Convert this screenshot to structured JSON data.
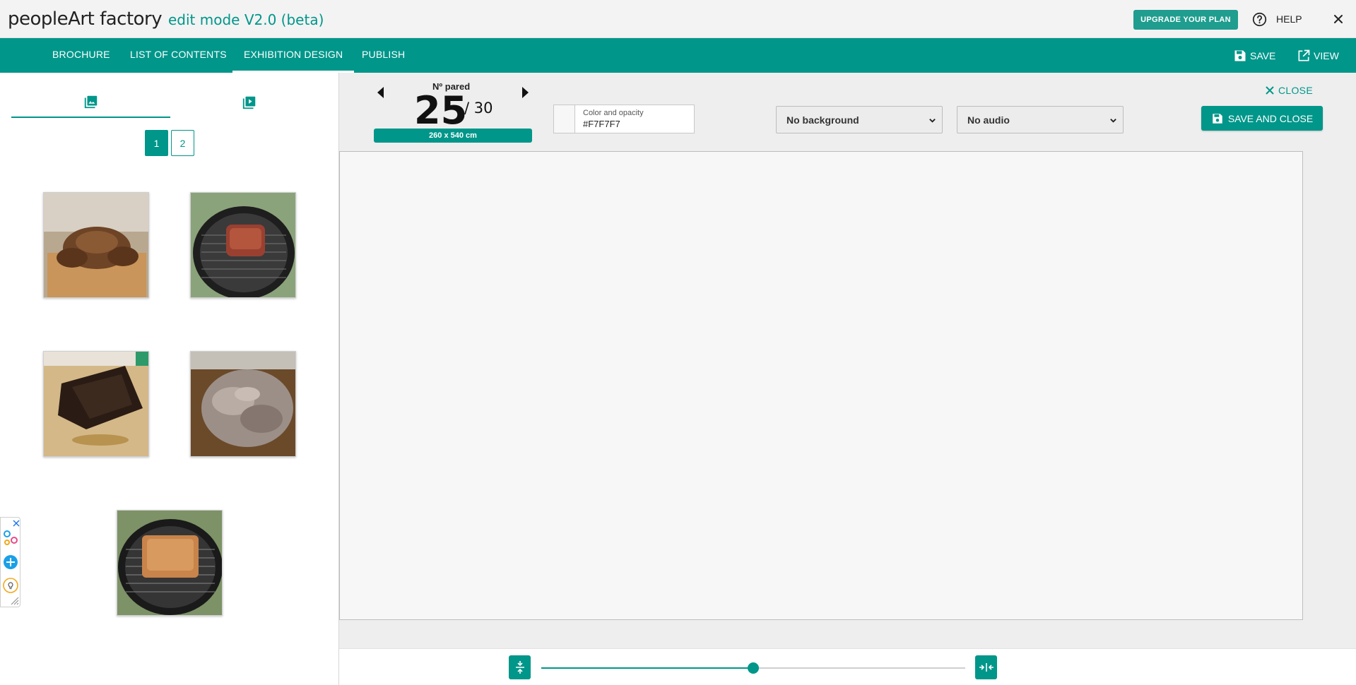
{
  "app": {
    "brand": "peopleArt factory",
    "mode": "edit mode V2.0 (beta)",
    "upgrade_label": "UPGRADE YOUR PLAN",
    "help_label": "HELP"
  },
  "nav": {
    "items": [
      {
        "label": "BROCHURE"
      },
      {
        "label": "LIST OF CONTENTS"
      },
      {
        "label": "EXHIBITION DESIGN",
        "active": true
      },
      {
        "label": "PUBLISH"
      }
    ],
    "save_label": "SAVE",
    "view_label": "VIEW"
  },
  "panel": {
    "tabs": [
      {
        "icon": "image-icon",
        "active": true
      },
      {
        "icon": "video-library-icon",
        "active": false
      }
    ],
    "pages": [
      {
        "label": "1",
        "active": true
      },
      {
        "label": "2",
        "active": false
      }
    ],
    "thumbnails": [
      {
        "icon": "grilled-chicken-photo"
      },
      {
        "icon": "meat-on-grill-photo"
      },
      {
        "icon": "brisket-on-board-photo"
      },
      {
        "icon": "pulled-pork-photo"
      },
      {
        "icon": "pork-on-grill-photo"
      }
    ]
  },
  "toolbar": {
    "pared_label": "Nº pared",
    "pared_number": "25",
    "pared_total": "/ 30",
    "dimensions": "260 x 540 cm",
    "color_label": "Color and opacity",
    "color_value": "#F7F7F7",
    "background_select": "No background",
    "audio_select": "No audio",
    "close_label": "CLOSE",
    "save_close_label": "SAVE AND CLOSE"
  },
  "zoom": {
    "level": 0.5
  },
  "colors": {
    "accent": "#00968a",
    "canvas": "#F7F7F7"
  }
}
